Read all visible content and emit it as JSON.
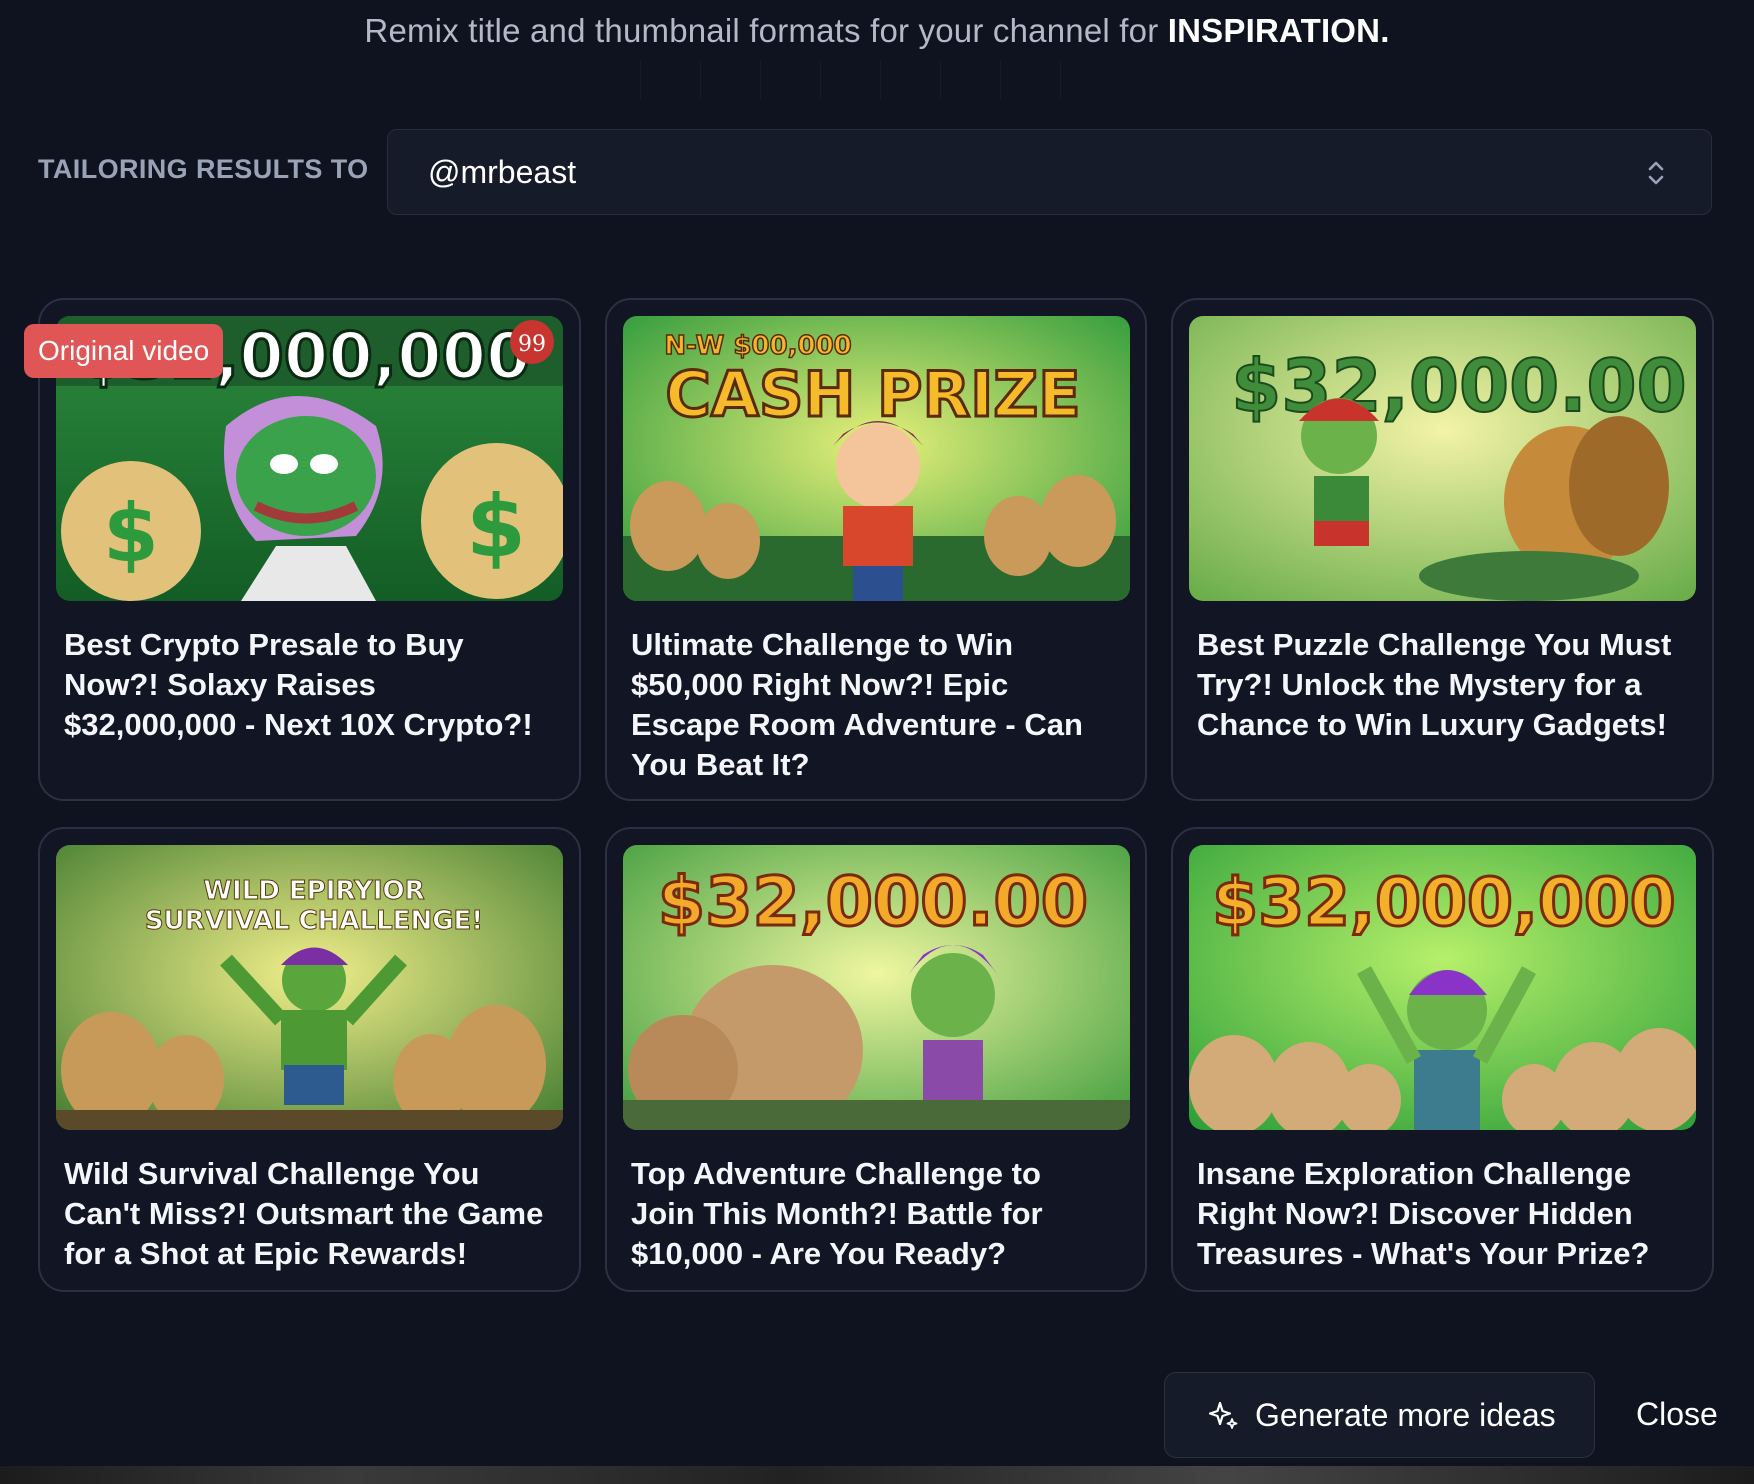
{
  "header": {
    "subtitle": "Remix title and thumbnail formats for your channel for",
    "subtitle_emphasis": "INSPIRATION."
  },
  "tailoring": {
    "label": "TAILORING RESULTS TO",
    "channel": "@mrbeast"
  },
  "cards": [
    {
      "badge": "Original video",
      "title": "Best Crypto Presale to Buy Now?! Solaxy Raises $32,000,000 - Next 10X Crypto?!",
      "thumb_text": "$32,000,000",
      "thumb_count": "99"
    },
    {
      "title": "Ultimate Challenge to Win $50,000 Right Now?! Epic Escape Room Adventure - Can You Beat It?",
      "thumb_small": "N-W $00,000",
      "thumb_text": "CASH PRIZE"
    },
    {
      "title": "Best Puzzle Challenge You Must Try?! Unlock the Mystery for a Chance to Win Luxury Gadgets!",
      "thumb_text": "$32,000.00"
    },
    {
      "title": "Wild Survival Challenge You Can't Miss?! Outsmart the Game for a Shot at Epic Rewards!",
      "thumb_line1": "WILD EPIRYIOR",
      "thumb_line2": "SURVIVAL CHALLENGE!"
    },
    {
      "title": "Top Adventure Challenge to Join This Month?! Battle for $10,000 - Are You Ready?",
      "thumb_text": "$32,000.00"
    },
    {
      "title": "Insane Exploration Challenge Right Now?! Discover Hidden Treasures - What's Your Prize?",
      "thumb_text": "$32,000,000"
    }
  ],
  "actions": {
    "generate_label": "Generate more ideas",
    "close_label": "Close"
  },
  "colors": {
    "background": "#0f1320",
    "badge": "#e05555",
    "card_border": "#2a3142"
  }
}
